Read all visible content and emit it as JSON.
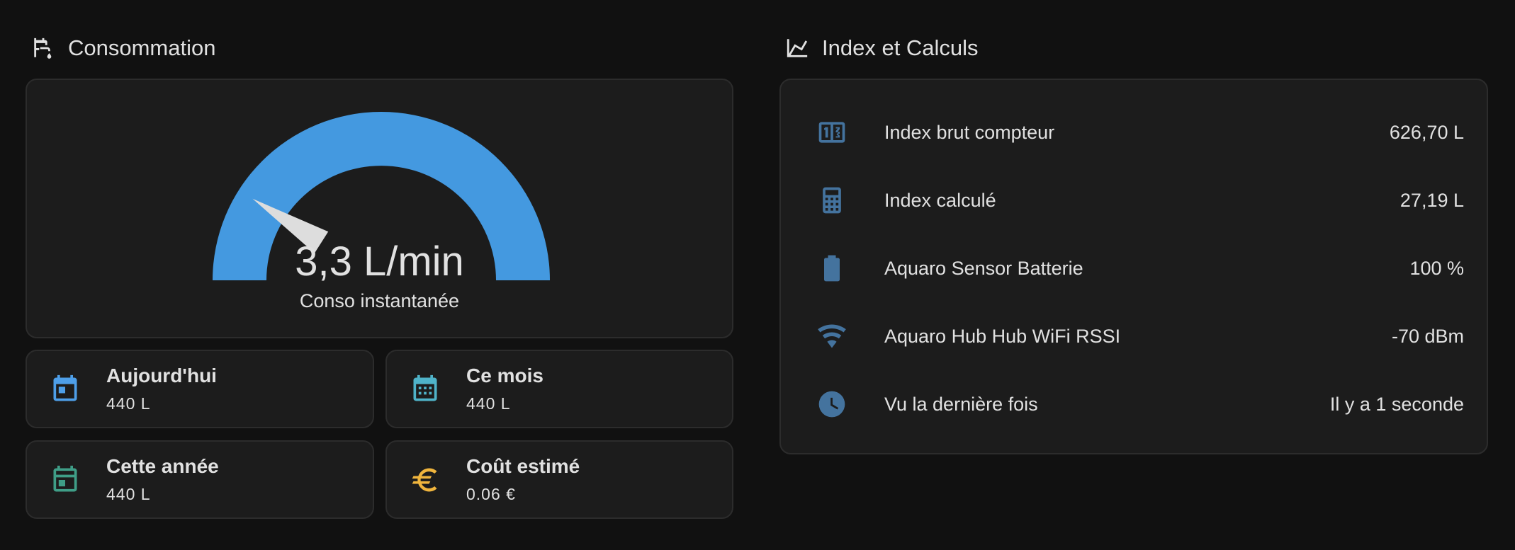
{
  "consommation": {
    "title": "Consommation",
    "icon": "water-pump-icon",
    "gauge": {
      "value_text": "3,3 L/min",
      "caption": "Conso instantanée",
      "level_fraction": 0.18,
      "arc_color": "#4499e0",
      "needle_color": "#dddddd"
    },
    "tiles": [
      {
        "name": "Aujourd'hui",
        "value": "440 L",
        "icon": "calendar-today-icon",
        "icon_color": "#4e9fe9"
      },
      {
        "name": "Ce mois",
        "value": "440 L",
        "icon": "calendar-month-icon",
        "icon_color": "#4fb3c9"
      },
      {
        "name": "Cette année",
        "value": "440 L",
        "icon": "calendar-range-icon",
        "icon_color": "#3f9e87"
      },
      {
        "name": "Coût estimé",
        "value": "0.06 €",
        "icon": "currency-eur-icon",
        "icon_color": "#f0b53d"
      }
    ]
  },
  "index": {
    "title": "Index et Calculs",
    "icon": "chart-line-icon",
    "icon_color": "#44739e",
    "rows": [
      {
        "name": "Index brut compteur",
        "state": "626,70 L",
        "icon": "counter-icon"
      },
      {
        "name": "Index calculé",
        "state": "27,19 L",
        "icon": "calculator-icon"
      },
      {
        "name": "Aquaro Sensor Batterie",
        "state": "100 %",
        "icon": "battery-icon"
      },
      {
        "name": "Aquaro Hub Hub WiFi RSSI",
        "state": "-70 dBm",
        "icon": "wifi-icon"
      },
      {
        "name": "Vu la dernière fois",
        "state": "Il y a 1 seconde",
        "icon": "clock-icon"
      }
    ]
  }
}
